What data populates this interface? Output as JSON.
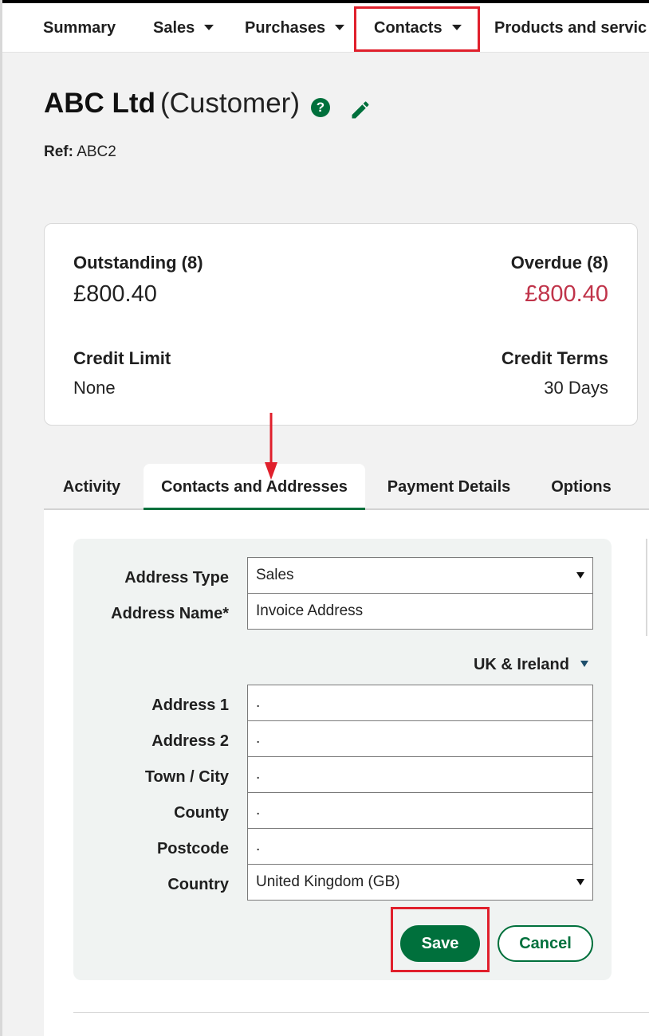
{
  "nav": {
    "items": [
      {
        "label": "Summary",
        "has_dropdown": false
      },
      {
        "label": "Sales",
        "has_dropdown": true
      },
      {
        "label": "Purchases",
        "has_dropdown": true
      },
      {
        "label": "Contacts",
        "has_dropdown": true,
        "highlighted": true
      },
      {
        "label": "Products and servic",
        "has_dropdown": false
      }
    ]
  },
  "header": {
    "name": "ABC Ltd",
    "type": "(Customer)",
    "help_glyph": "?",
    "ref_label": "Ref:",
    "ref_value": "ABC2"
  },
  "summary": {
    "outstanding_label": "Outstanding (8)",
    "outstanding_value": "£800.40",
    "overdue_label": "Overdue (8)",
    "overdue_value": "£800.40",
    "credit_limit_label": "Credit Limit",
    "credit_limit_value": "None",
    "credit_terms_label": "Credit Terms",
    "credit_terms_value": "30 Days"
  },
  "tabs": [
    {
      "label": "Activity",
      "active": false
    },
    {
      "label": "Contacts and Addresses",
      "active": true
    },
    {
      "label": "Payment Details",
      "active": false
    },
    {
      "label": "Options",
      "active": false
    }
  ],
  "form": {
    "address_type_label": "Address Type",
    "address_type_value": "Sales",
    "address_name_label": "Address Name*",
    "address_name_value": "Invoice Address",
    "region_label": "UK & Ireland",
    "address1_label": "Address 1",
    "address1_value": ".",
    "address2_label": "Address 2",
    "address2_value": ".",
    "town_label": "Town / City",
    "town_value": ".",
    "county_label": "County",
    "county_value": ".",
    "postcode_label": "Postcode",
    "postcode_value": ".",
    "country_label": "Country",
    "country_value": "United Kingdom (GB)"
  },
  "buttons": {
    "save_label": "Save",
    "cancel_label": "Cancel"
  },
  "colors": {
    "brand_green": "#00703c",
    "overdue_red": "#c0344a",
    "annotation_red": "#e0202c"
  },
  "icons": {
    "help": "help-icon",
    "edit": "pencil-icon",
    "annotation_arrow": "annotation-arrow"
  }
}
